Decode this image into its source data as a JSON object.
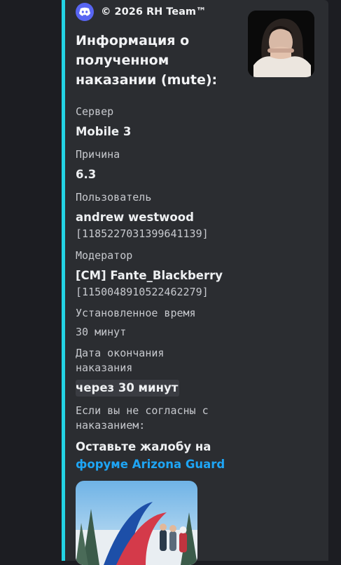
{
  "embed": {
    "author": {
      "icon": "discord-logo-icon",
      "name": "© 2026 RH Team™"
    },
    "accent_color": "#23d3e4",
    "title": "Информация о полученном наказании (mute):",
    "fields": {
      "server_label": "Сервер",
      "server_value": "Mobile 3",
      "reason_label": "Причина",
      "reason_value": "6.3",
      "user_label": "Пользователь",
      "user_name": "andrew westwood",
      "user_id": "[1185227031399641139]",
      "moderator_label": "Модератор",
      "moderator_name": "[CM] Fante_Blackberry",
      "moderator_id": "[1150048910522462279]",
      "duration_label": "Установленное время",
      "duration_value": "30 минут",
      "end_label_line1": "Дата окончания",
      "end_label_line2": "наказания",
      "end_value": "через 30 минут",
      "disagree_line1": "Если вы не согласны с",
      "disagree_line2": "наказанием:",
      "complaint_text": "Оставьте жалобу на",
      "complaint_link": "форуме Arizona Guard"
    }
  },
  "colors": {
    "background": "#1c1d22",
    "embed_background": "#2b2d31",
    "link": "#1ea5f5"
  }
}
